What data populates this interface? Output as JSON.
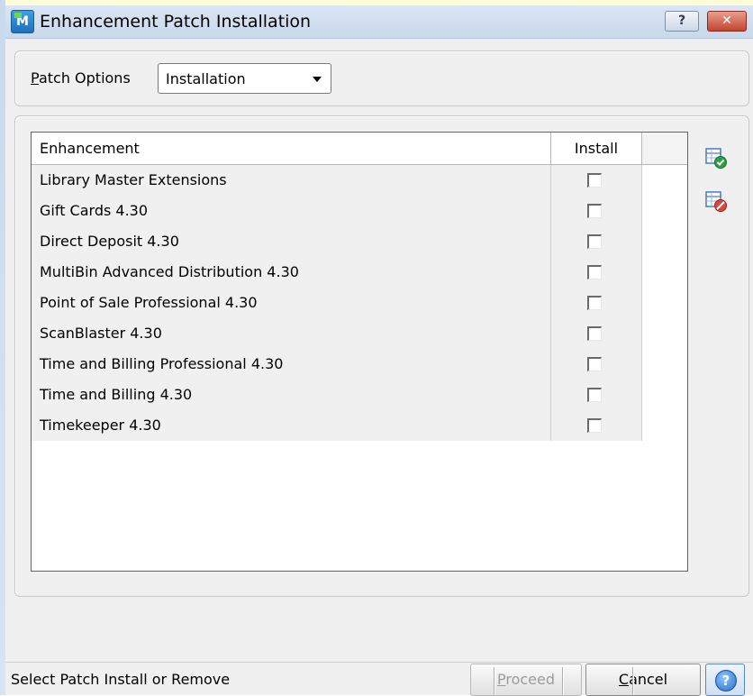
{
  "window": {
    "title": "Enhancement Patch Installation",
    "help_glyph": "?",
    "close_glyph": "✕"
  },
  "options": {
    "label_prefix": "P",
    "label_rest": "atch Options",
    "selected": "Installation"
  },
  "grid": {
    "columns": [
      "Enhancement",
      "Install"
    ],
    "rows": [
      {
        "name": "Library Master Extensions",
        "install": false
      },
      {
        "name": "Gift Cards 4.30",
        "install": false
      },
      {
        "name": "Direct Deposit 4.30",
        "install": false
      },
      {
        "name": "MultiBin Advanced Distribution 4.30",
        "install": false
      },
      {
        "name": "Point of Sale Professional 4.30",
        "install": false
      },
      {
        "name": "ScanBlaster 4.30",
        "install": false
      },
      {
        "name": "Time and Billing Professional 4.30",
        "install": false
      },
      {
        "name": "Time and Billing 4.30",
        "install": false
      },
      {
        "name": "Timekeeper 4.30",
        "install": false
      }
    ]
  },
  "buttons": {
    "proceed_prefix": "P",
    "proceed_rest": "roceed",
    "cancel_prefix": "C",
    "cancel_rest": "ancel",
    "help_glyph": "?"
  },
  "status": {
    "text": "Select Patch Install or Remove"
  },
  "icons": {
    "select_all": "select-all-icon",
    "deselect_all": "deselect-all-icon"
  }
}
